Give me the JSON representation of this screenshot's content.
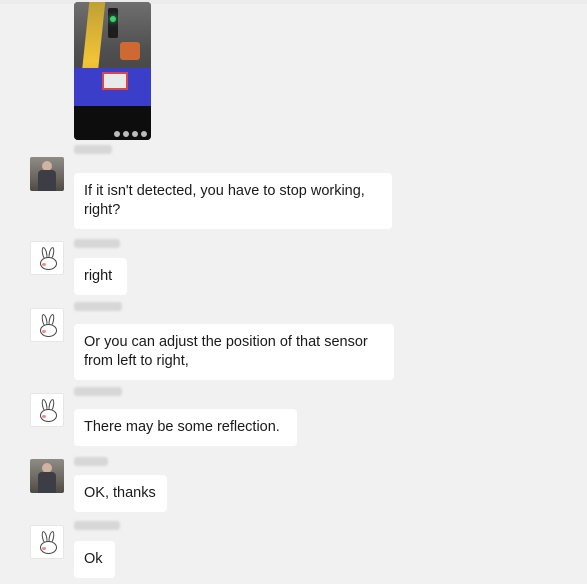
{
  "chat": {
    "image_message": {
      "icon": "photo-attachment"
    },
    "messages": [
      {
        "sender": "person",
        "text": "If it isn't detected, you have to stop working, right?"
      },
      {
        "sender": "bunny",
        "text": "right"
      },
      {
        "sender": "bunny",
        "text": "Or you can adjust the position of that sensor from left to right,"
      },
      {
        "sender": "bunny",
        "text": "There may be some reflection."
      },
      {
        "sender": "person",
        "text": "OK, thanks"
      },
      {
        "sender": "bunny",
        "text": "Ok"
      }
    ]
  }
}
